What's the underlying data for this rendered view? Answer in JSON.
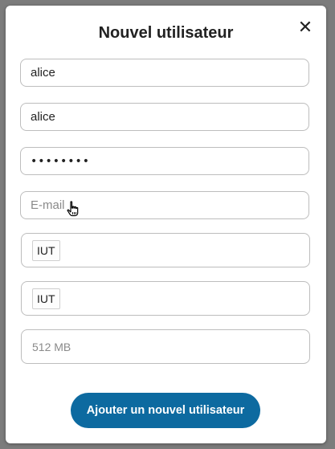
{
  "dialog": {
    "title": "Nouvel utilisateur",
    "close_icon": "close-icon",
    "close_glyph": "✕"
  },
  "fields": {
    "username_value": "alice",
    "display_name_value": "alice",
    "password_value": "••••••••",
    "email_placeholder": "E-mail",
    "email_value": ""
  },
  "groups": {
    "tag": "IUT"
  },
  "subadmin_groups": {
    "tag": "IUT"
  },
  "quota": {
    "placeholder": "512 MB"
  },
  "actions": {
    "submit_label": "Ajouter un nouvel utilisateur"
  },
  "colors": {
    "primary": "#0d6aa0",
    "backdrop": "#7c7c7c"
  }
}
